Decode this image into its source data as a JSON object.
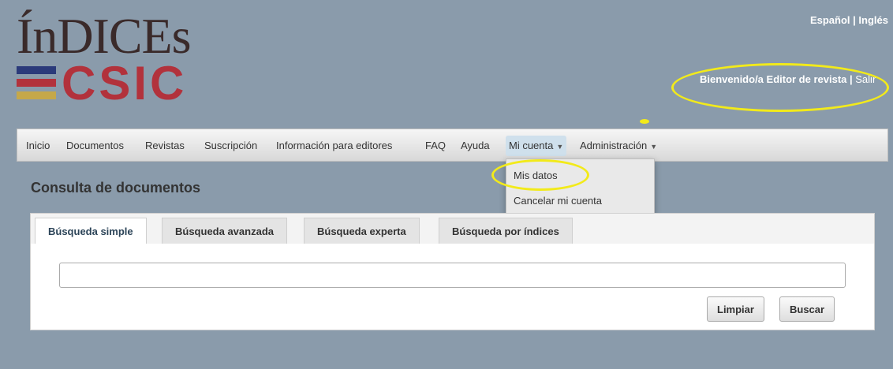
{
  "brand": {
    "logo_top": "ÍnDICEs",
    "logo_bottom": "CSIC",
    "bar_colors": [
      "#2b3a7a",
      "#b2323c",
      "#c5a84a"
    ]
  },
  "header": {
    "lang_es": "Español",
    "lang_sep": " | ",
    "lang_en": "Inglés",
    "welcome": "Bienvenido/a Editor de revista",
    "welcome_sep": " | ",
    "logout": "Salir"
  },
  "nav": {
    "items": [
      "Inicio",
      "Documentos",
      "Revistas",
      "Suscripción",
      "Información para editores",
      "FAQ",
      "Ayuda",
      "Mi cuenta",
      "Administración"
    ],
    "active": "Mi cuenta"
  },
  "dropdown": {
    "items": [
      "Mis datos",
      "Cancelar mi cuenta"
    ]
  },
  "main": {
    "title": "Consulta de documentos",
    "tabs": [
      "Búsqueda simple",
      "Búsqueda avanzada",
      "Búsqueda experta",
      "Búsqueda por índices"
    ],
    "active_tab": "Búsqueda simple",
    "search_value": "",
    "clear_label": "Limpiar",
    "search_label": "Buscar"
  },
  "colors": {
    "background": "#8a9bab",
    "highlight": "#f2ea1a",
    "accent": "#b2323c"
  }
}
